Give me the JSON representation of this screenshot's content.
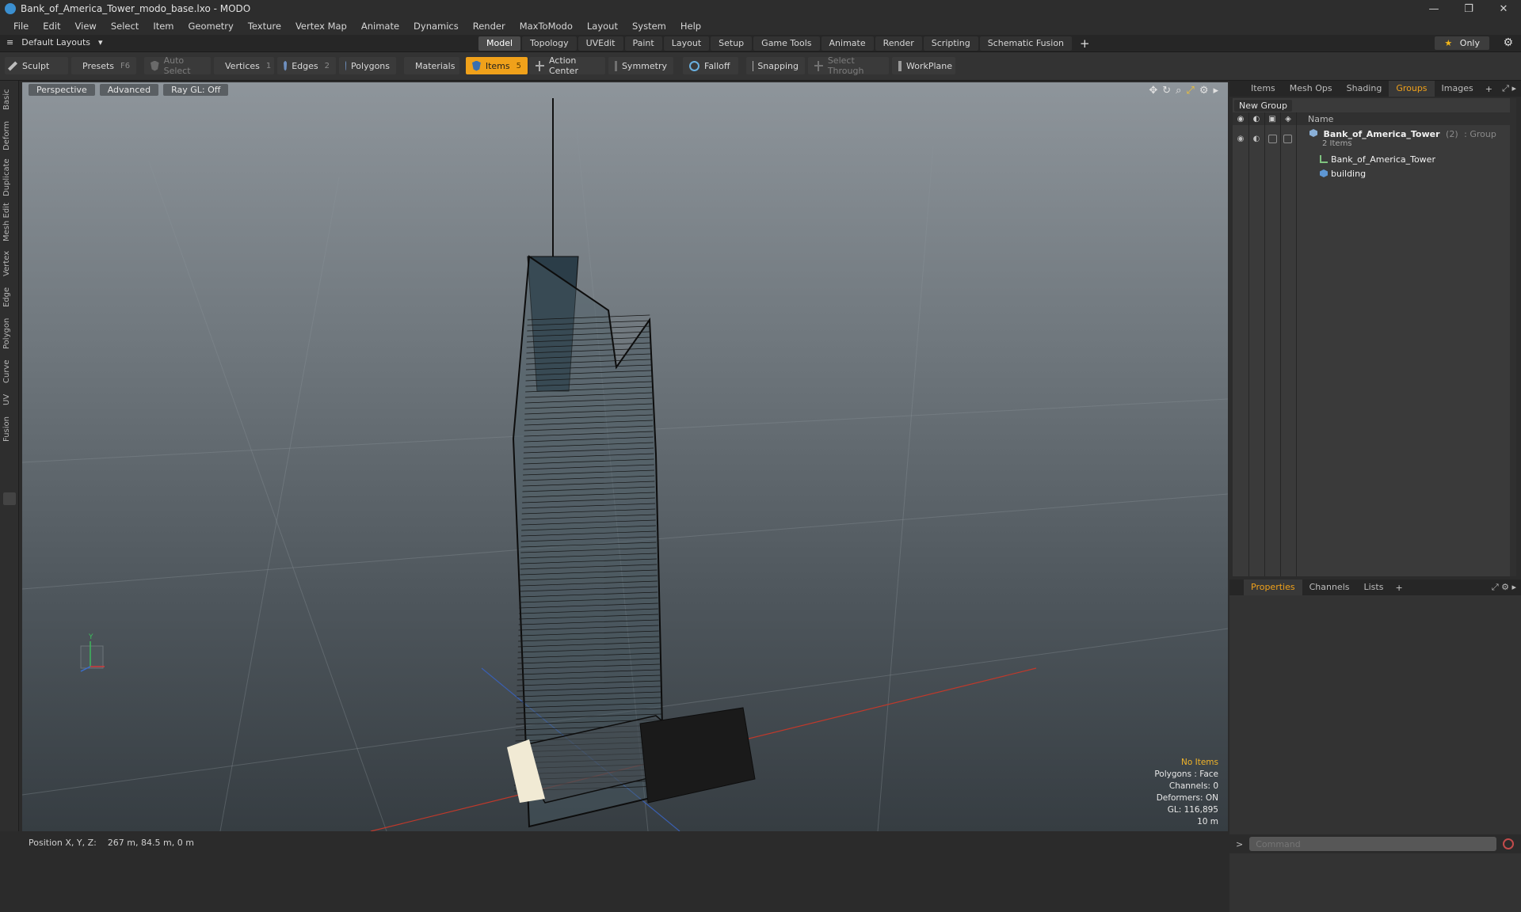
{
  "window": {
    "title": "Bank_of_America_Tower_modo_base.lxo - MODO",
    "controls": [
      "—",
      "❐",
      "✕"
    ]
  },
  "menu": [
    "File",
    "Edit",
    "View",
    "Select",
    "Item",
    "Geometry",
    "Texture",
    "Vertex Map",
    "Animate",
    "Dynamics",
    "Render",
    "MaxToModo",
    "Layout",
    "System",
    "Help"
  ],
  "layout_selector": "Default Layouts",
  "layout_tabs": [
    "Model",
    "Topology",
    "UVEdit",
    "Paint",
    "Layout",
    "Setup",
    "Game Tools",
    "Animate",
    "Render",
    "Scripting",
    "Schematic Fusion"
  ],
  "active_layout_tab": "Model",
  "only_button": "Only",
  "toolbar": {
    "sculpt": "Sculpt",
    "presets": "Presets",
    "presets_key": "F6",
    "auto_select": "Auto Select",
    "vertices": "Vertices",
    "vertices_key": "1",
    "edges": "Edges",
    "edges_key": "2",
    "polygons": "Polygons",
    "materials": "Materials",
    "items": "Items",
    "items_key": "5",
    "action_center": "Action Center",
    "symmetry": "Symmetry",
    "falloff": "Falloff",
    "snapping": "Snapping",
    "select_through": "Select Through",
    "workplane": "WorkPlane"
  },
  "left_tabs": [
    "Basic",
    "Deform",
    "Duplicate",
    "Mesh Edit",
    "Vertex",
    "Edge",
    "Polygon",
    "Curve",
    "UV",
    "Fusion"
  ],
  "viewport": {
    "view_mode": "Perspective",
    "shading": "Advanced",
    "raygl": "Ray GL: Off",
    "info": {
      "selection": "No Items",
      "polygons": "Polygons : Face",
      "channels": "Channels: 0",
      "deformers": "Deformers: ON",
      "gl": "GL: 116,895",
      "scale": "10 m"
    },
    "axis_label": "Y"
  },
  "status": {
    "label": "Position X, Y, Z:",
    "value": "267 m, 84.5 m, 0 m"
  },
  "right_panel": {
    "top_tabs": [
      "Items",
      "Mesh Ops",
      "Shading",
      "Groups",
      "Images"
    ],
    "active_top_tab": "Groups",
    "new_group": "New Group",
    "column_name": "Name",
    "group": {
      "name": "Bank_of_America_Tower",
      "count": "(2)",
      "type": ": Group",
      "subtitle": "2 Items",
      "children": [
        "Bank_of_America_Tower",
        "building"
      ]
    },
    "bottom_tabs": [
      "Properties",
      "Channels",
      "Lists"
    ],
    "active_bottom_tab": "Properties",
    "command_placeholder": "Command"
  },
  "colors": {
    "accent": "#f0a11a",
    "viewport_top": "#8e959b",
    "viewport_bottom": "#363d42"
  }
}
